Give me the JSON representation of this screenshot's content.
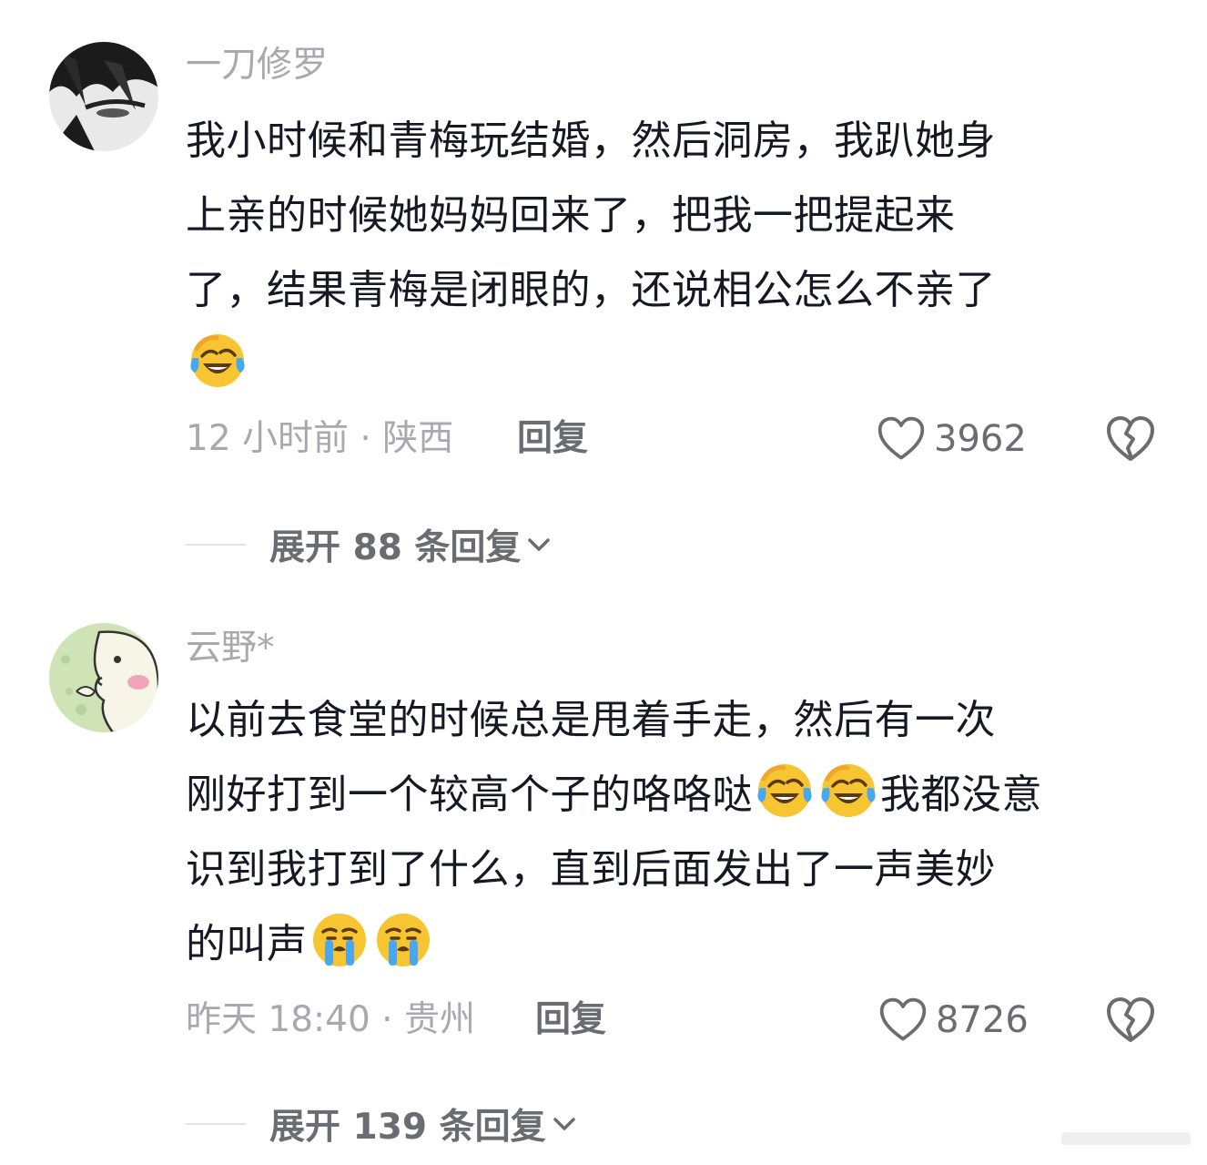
{
  "comments": [
    {
      "username": "一刀修罗",
      "avatar": "anime-character-avatar",
      "lines": [
        "我小时候和青梅玩结婚，然后洞房，我趴她身",
        "上亲的时候她妈妈回来了，把我一把提起来",
        "了，结果青梅是闭眼的，还说相公怎么不亲了"
      ],
      "trailing_emoji": "laugh-cry-emoji",
      "time_location": "12 小时前 · 陕西",
      "reply_label": "回复",
      "likes": "3962",
      "expand_label": "展开 88 条回复"
    },
    {
      "username": "云野*",
      "avatar": "cartoon-face-avatar",
      "line1": "以前去食堂的时候总是甩着手走，然后有一次",
      "line2_start": "刚好打到一个较高个子的咯咯哒",
      "line2_end": "我都没意",
      "line3": "识到我打到了什么，直到后面发出了一声美妙",
      "line4": "的叫声",
      "time_location": "昨天 18:40 · 贵州",
      "reply_label": "回复",
      "likes": "8726",
      "expand_label": "展开 139 条回复"
    }
  ],
  "colors": {
    "text_primary": "#161823",
    "text_secondary": "#a8a8ae",
    "text_action": "#6b6b72",
    "emoji_yellow": "#f7c531",
    "emoji_tear": "#49a7f2"
  }
}
